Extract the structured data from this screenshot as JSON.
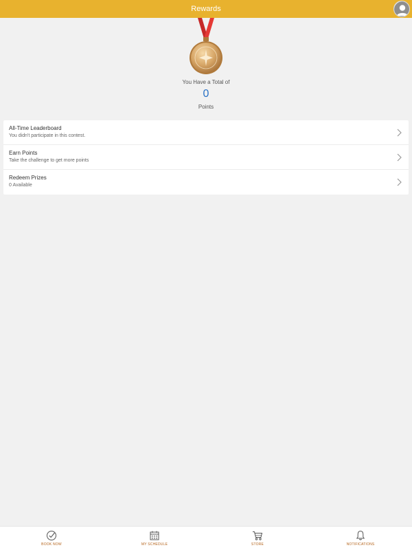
{
  "header": {
    "title": "Rewards",
    "profile_icon": "user-avatar-icon",
    "background_color": "#e8b22e"
  },
  "points": {
    "caption": "You Have a Total of",
    "value": "0",
    "unit": "Points",
    "value_color": "#2a72c6",
    "medal_icon": "medal-icon"
  },
  "menu": {
    "items": [
      {
        "title": "All-Time Leaderboard",
        "subtitle": "You didn't participate in this contest."
      },
      {
        "title": "Earn Points",
        "subtitle": "Take the challenge to get more points"
      },
      {
        "title": "Redeem Prizes",
        "subtitle": "0 Available"
      }
    ]
  },
  "tabbar": {
    "label_color": "#b5651d",
    "tabs": [
      {
        "label": "BOOK NOW",
        "icon": "check-circle-icon"
      },
      {
        "label": "MY SCHEDULE",
        "icon": "calendar-icon"
      },
      {
        "label": "STORE",
        "icon": "cart-icon"
      },
      {
        "label": "NOTIFICATIONS",
        "icon": "bell-icon"
      }
    ]
  }
}
